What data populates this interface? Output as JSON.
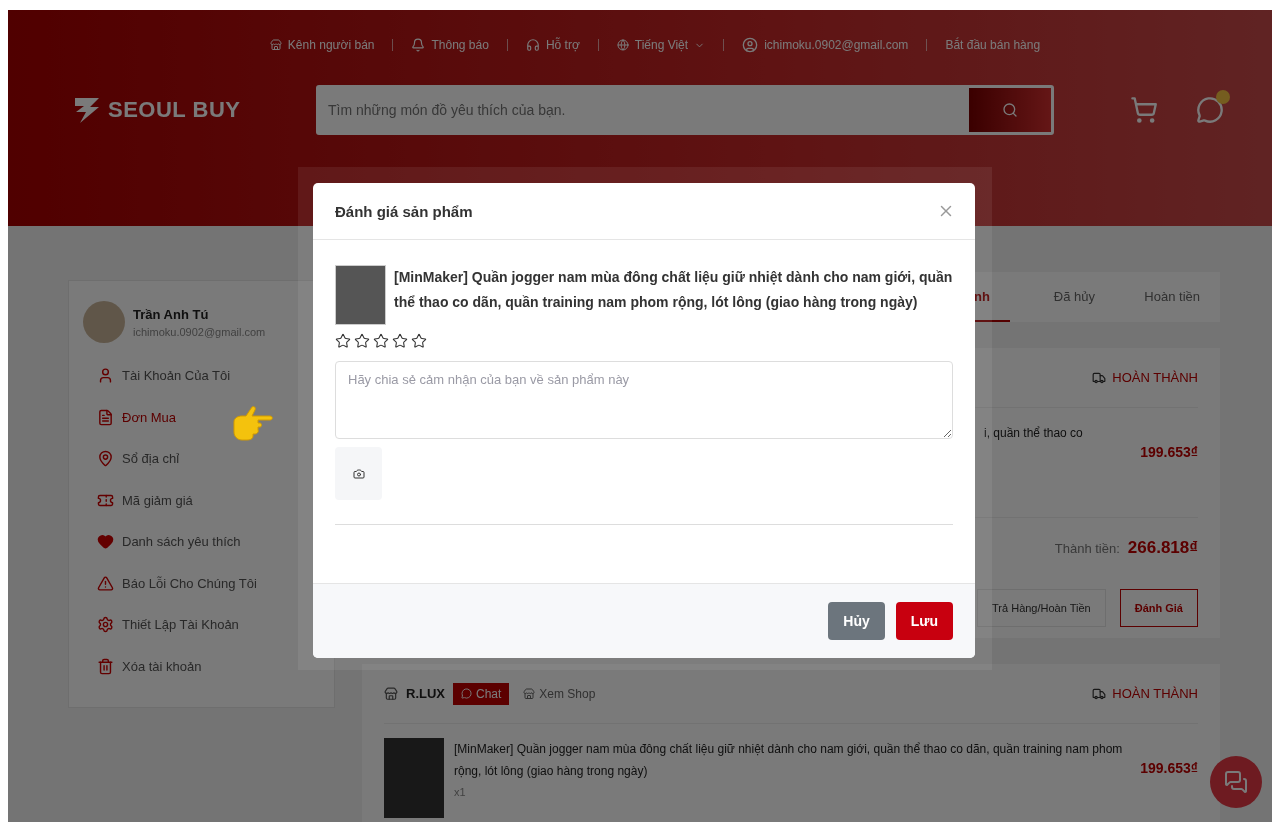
{
  "top_bar": {
    "links": [
      {
        "label": "Kênh người bán",
        "kind": "store"
      },
      {
        "label": "Thông báo",
        "kind": "bell"
      },
      {
        "label": "Hỗ trợ",
        "kind": "support"
      },
      {
        "label": "Tiếng Việt",
        "kind": "language"
      },
      {
        "label": "ichimoku.0902@gmail.com",
        "kind": "user"
      },
      {
        "label": "Bắt đầu bán hàng",
        "kind": "plain"
      }
    ]
  },
  "logo": {
    "text": "SEOUL BUY"
  },
  "search": {
    "placeholder": "Tìm những món đồ yêu thích của bạn."
  },
  "sidebar": {
    "user": {
      "name": "Trần Anh Tú",
      "email": "ichimoku.0902@gmail.com"
    },
    "items": [
      {
        "label": "Tài Khoản Của Tôi",
        "kind": "account",
        "selected": false
      },
      {
        "label": "Đơn Mua",
        "kind": "orders",
        "selected": true
      },
      {
        "label": "Sổ địa chỉ",
        "kind": "address",
        "selected": false
      },
      {
        "label": "Mã giảm giá",
        "kind": "voucher",
        "selected": false
      },
      {
        "label": "Danh sách yêu thích",
        "kind": "wishlist",
        "selected": false
      },
      {
        "label": "Báo Lỗi Cho Chúng Tôi",
        "kind": "report",
        "selected": false
      },
      {
        "label": "Thiết Lập Tài Khoản",
        "kind": "settings",
        "selected": false
      },
      {
        "label": "Xóa tài khoản",
        "kind": "delete",
        "selected": false
      }
    ]
  },
  "tabs": [
    {
      "label": "nh",
      "selected": true
    },
    {
      "label": "Đã hủy",
      "selected": false
    },
    {
      "label": "Hoàn tiền",
      "selected": false
    }
  ],
  "orders": [
    {
      "status": "HOÀN THÀNH",
      "product": "i, quần thể thao co",
      "price": "199.653₫",
      "total_label": "Thành tiền:",
      "total": "266.818₫",
      "actions": [
        {
          "label": "Trả Hàng/Hoàn Tiền",
          "kind": "plain"
        },
        {
          "label": "Đánh Giá",
          "kind": "outline"
        }
      ]
    },
    {
      "shop": "R.LUX",
      "chat": "Chat",
      "view_shop": "Xem Shop",
      "status": "HOÀN THÀNH",
      "product": "[MinMaker] Quần jogger nam mùa đông chất liệu giữ nhiệt dành cho nam giới, quần thể thao co dãn, quần training nam phom rộng, lót lông (giao hàng trong ngày)",
      "quantity": "x1",
      "price": "199.653₫"
    }
  ],
  "modal": {
    "title": "Đánh giá sản phẩm",
    "product": "[MinMaker] Quần jogger nam mùa đông chất liệu giữ nhiệt dành cho nam giới, quần thể thao co dãn, quần training nam phom rộng, lót lông (giao hàng trong ngày)",
    "stars": 0,
    "review": {
      "placeholder": "Hãy chia sẻ cảm nhận của bạn về sản phẩm này"
    },
    "buttons": [
      {
        "label": "Hủy",
        "kind": "secondary"
      },
      {
        "label": "Lưu",
        "kind": "primary"
      }
    ]
  }
}
